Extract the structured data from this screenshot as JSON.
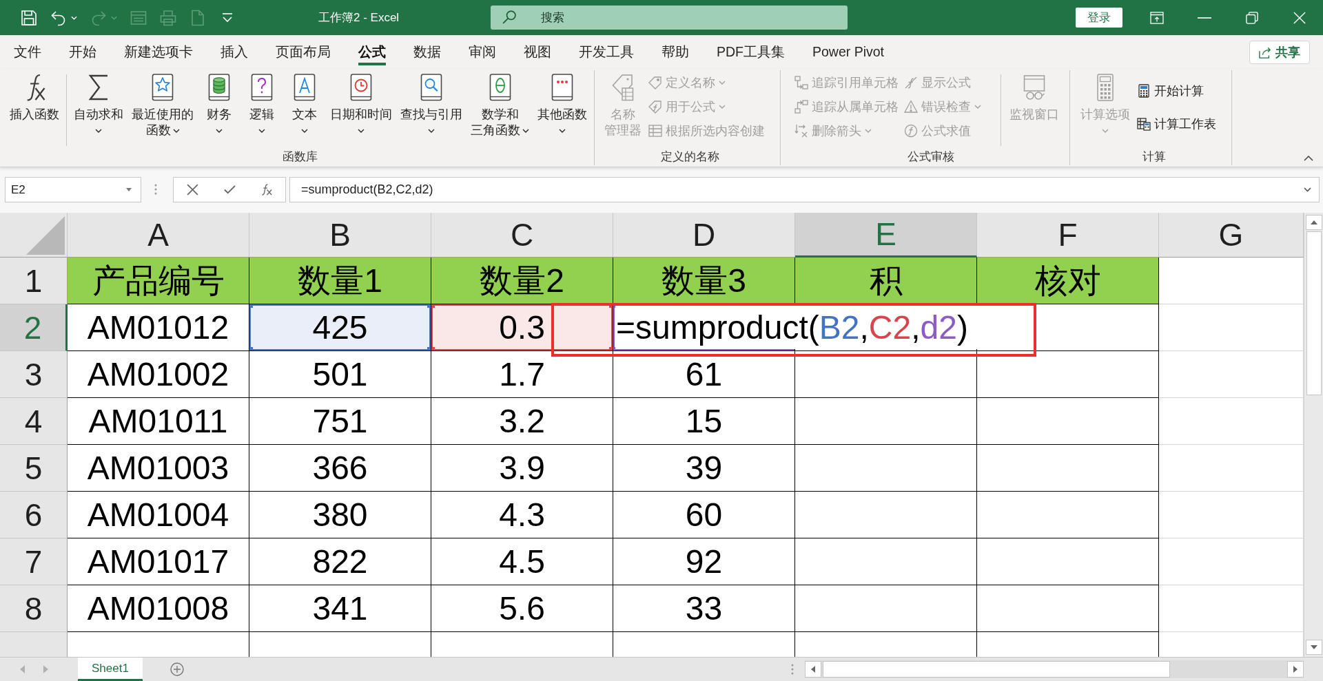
{
  "title_bar": {
    "quick_access": [
      {
        "disabled": false,
        "menu": false
      },
      {
        "disabled": false,
        "menu": true
      },
      {
        "disabled": true,
        "menu": true
      },
      {
        "disabled": true,
        "menu": false
      },
      {
        "disabled": true,
        "menu": false
      },
      {
        "disabled": true,
        "menu": false
      },
      {
        "disabled": false,
        "menu": false
      }
    ],
    "title": "工作簿2 - Excel",
    "search": {
      "placeholder": "搜索"
    },
    "login_button": "登录"
  },
  "ribbon_tabs": [
    {
      "label": "文件",
      "selected": false
    },
    {
      "label": "开始",
      "selected": false
    },
    {
      "label": "新建选项卡",
      "selected": false
    },
    {
      "label": "插入",
      "selected": false
    },
    {
      "label": "页面布局",
      "selected": false
    },
    {
      "label": "公式",
      "selected": true
    },
    {
      "label": "数据",
      "selected": false
    },
    {
      "label": "审阅",
      "selected": false
    },
    {
      "label": "视图",
      "selected": false
    },
    {
      "label": "开发工具",
      "selected": false
    },
    {
      "label": "帮助",
      "selected": false
    },
    {
      "label": "PDF工具集",
      "selected": false
    },
    {
      "label": "Power Pivot",
      "selected": false
    }
  ],
  "share_button": {
    "label": "共享"
  },
  "ribbon_groups": [
    {
      "label": "函数库",
      "items": [
        {
          "kind": "large",
          "lines": [
            "插入函数"
          ],
          "menu": false,
          "disabled": false
        },
        {
          "kind": "separator"
        },
        {
          "kind": "large",
          "lines": [
            "自动求和"
          ],
          "menu": true,
          "disabled": false
        },
        {
          "kind": "large",
          "lines": [
            "最近使用的",
            "函数"
          ],
          "menu": true,
          "disabled": false
        },
        {
          "kind": "large",
          "lines": [
            "财务"
          ],
          "menu": true,
          "disabled": false
        },
        {
          "kind": "large",
          "lines": [
            "逻辑"
          ],
          "menu": true,
          "disabled": false
        },
        {
          "kind": "large",
          "lines": [
            "文本"
          ],
          "menu": true,
          "disabled": false
        },
        {
          "kind": "large",
          "lines": [
            "日期和时间"
          ],
          "menu": true,
          "disabled": false
        },
        {
          "kind": "large",
          "lines": [
            "查找与引用"
          ],
          "menu": true,
          "disabled": false
        },
        {
          "kind": "large",
          "lines": [
            "数学和",
            "三角函数"
          ],
          "menu": true,
          "disabled": false
        },
        {
          "kind": "large",
          "lines": [
            "其他函数"
          ],
          "menu": true,
          "disabled": false
        }
      ]
    },
    {
      "label": "定义的名称",
      "items": [
        {
          "kind": "large",
          "lines": [
            "名称",
            "管理器"
          ],
          "menu": false,
          "disabled": true
        },
        {
          "kind": "stack",
          "commands": [
            {
              "label": "定义名称",
              "menu": true,
              "disabled": true
            },
            {
              "label": "用于公式",
              "menu": true,
              "disabled": true
            },
            {
              "label": "根据所选内容创建",
              "menu": false,
              "disabled": true
            }
          ]
        }
      ]
    },
    {
      "label": "公式审核",
      "items": [
        {
          "kind": "stack",
          "commands": [
            {
              "label": "追踪引用单元格",
              "menu": false,
              "disabled": true
            },
            {
              "label": "追踪从属单元格",
              "menu": false,
              "disabled": true
            },
            {
              "label": "删除箭头",
              "menu": true,
              "disabled": true
            }
          ]
        },
        {
          "kind": "stack",
          "commands": [
            {
              "label": "显示公式",
              "menu": false,
              "disabled": true
            },
            {
              "label": "错误检查",
              "menu": true,
              "disabled": true
            },
            {
              "label": "公式求值",
              "menu": false,
              "disabled": true
            }
          ]
        },
        {
          "kind": "separator"
        },
        {
          "kind": "large",
          "lines": [
            "监视窗口"
          ],
          "menu": false,
          "disabled": true
        }
      ]
    },
    {
      "label": "计算",
      "items": [
        {
          "kind": "large",
          "lines": [
            "计算选项"
          ],
          "menu": true,
          "disabled": true
        },
        {
          "kind": "stack",
          "commands": [
            {
              "label": "开始计算",
              "menu": false,
              "disabled": false
            },
            {
              "label": "计算工作表",
              "menu": false,
              "disabled": false
            }
          ]
        }
      ]
    }
  ],
  "formula_bar": {
    "name_box": "E2",
    "value": "=sumproduct(B2,C2,d2)"
  },
  "sheet": {
    "columns": [
      {
        "label": "A",
        "kind": "bordered",
        "selected": false
      },
      {
        "label": "B",
        "kind": "bordered",
        "selected": false
      },
      {
        "label": "C",
        "kind": "bordered",
        "selected": false
      },
      {
        "label": "D",
        "kind": "bordered",
        "selected": false
      },
      {
        "label": "E",
        "kind": "bordered",
        "selected": true
      },
      {
        "label": "F",
        "kind": "bordered",
        "selected": false
      },
      {
        "label": "G",
        "kind": "plain",
        "selected": false
      }
    ],
    "rows": [
      {
        "label": "1",
        "kind": "header",
        "selected": false,
        "cells": [
          {
            "text": "产品编号"
          },
          {
            "text": "数量1"
          },
          {
            "text": "数量2"
          },
          {
            "text": "数量3"
          },
          {
            "text": "积"
          },
          {
            "text": "核对"
          }
        ]
      },
      {
        "label": "2",
        "kind": "data",
        "selected": true,
        "cells": [
          {
            "text": "AM01012"
          },
          {
            "text": "425",
            "color": "#4472c4"
          },
          {
            "text": "0.3",
            "color": "#d9434b"
          },
          {
            "color": "#8e5bc4"
          }
        ]
      },
      {
        "label": "3",
        "kind": "data",
        "selected": false,
        "cells": [
          {
            "text": "AM01002"
          },
          {
            "text": "501"
          },
          {
            "text": "1.7"
          },
          {
            "text": "61"
          }
        ]
      },
      {
        "label": "4",
        "kind": "data",
        "selected": false,
        "cells": [
          {
            "text": "AM01011"
          },
          {
            "text": "751"
          },
          {
            "text": "3.2"
          },
          {
            "text": "15"
          }
        ]
      },
      {
        "label": "5",
        "kind": "data",
        "selected": false,
        "cells": [
          {
            "text": "AM01003"
          },
          {
            "text": "366"
          },
          {
            "text": "3.9"
          },
          {
            "text": "39"
          }
        ]
      },
      {
        "label": "6",
        "kind": "data",
        "selected": false,
        "cells": [
          {
            "text": "AM01004"
          },
          {
            "text": "380"
          },
          {
            "text": "4.3"
          },
          {
            "text": "60"
          }
        ]
      },
      {
        "label": "7",
        "kind": "data",
        "selected": false,
        "cells": [
          {
            "text": "AM01017"
          },
          {
            "text": "822"
          },
          {
            "text": "4.5"
          },
          {
            "text": "92"
          }
        ]
      },
      {
        "label": "8",
        "kind": "data",
        "selected": false,
        "cells": [
          {
            "text": "AM01008"
          },
          {
            "text": "341"
          },
          {
            "text": "5.6"
          },
          {
            "text": "33"
          }
        ]
      },
      {
        "kind": "data",
        "selected": false
      }
    ],
    "edit": {
      "parts": [
        {
          "text": "=sumproduct("
        },
        {
          "text": "B2",
          "color": "#4472c4"
        },
        {
          "text": ","
        },
        {
          "text": "C2",
          "color": "#d9434b"
        },
        {
          "text": ","
        },
        {
          "text": "d2",
          "color": "#8e5bc4"
        },
        {
          "text": ")"
        }
      ]
    },
    "annotation_frame": true
  },
  "sheet_tabs": [
    {
      "label": "Sheet1",
      "selected": true
    }
  ]
}
